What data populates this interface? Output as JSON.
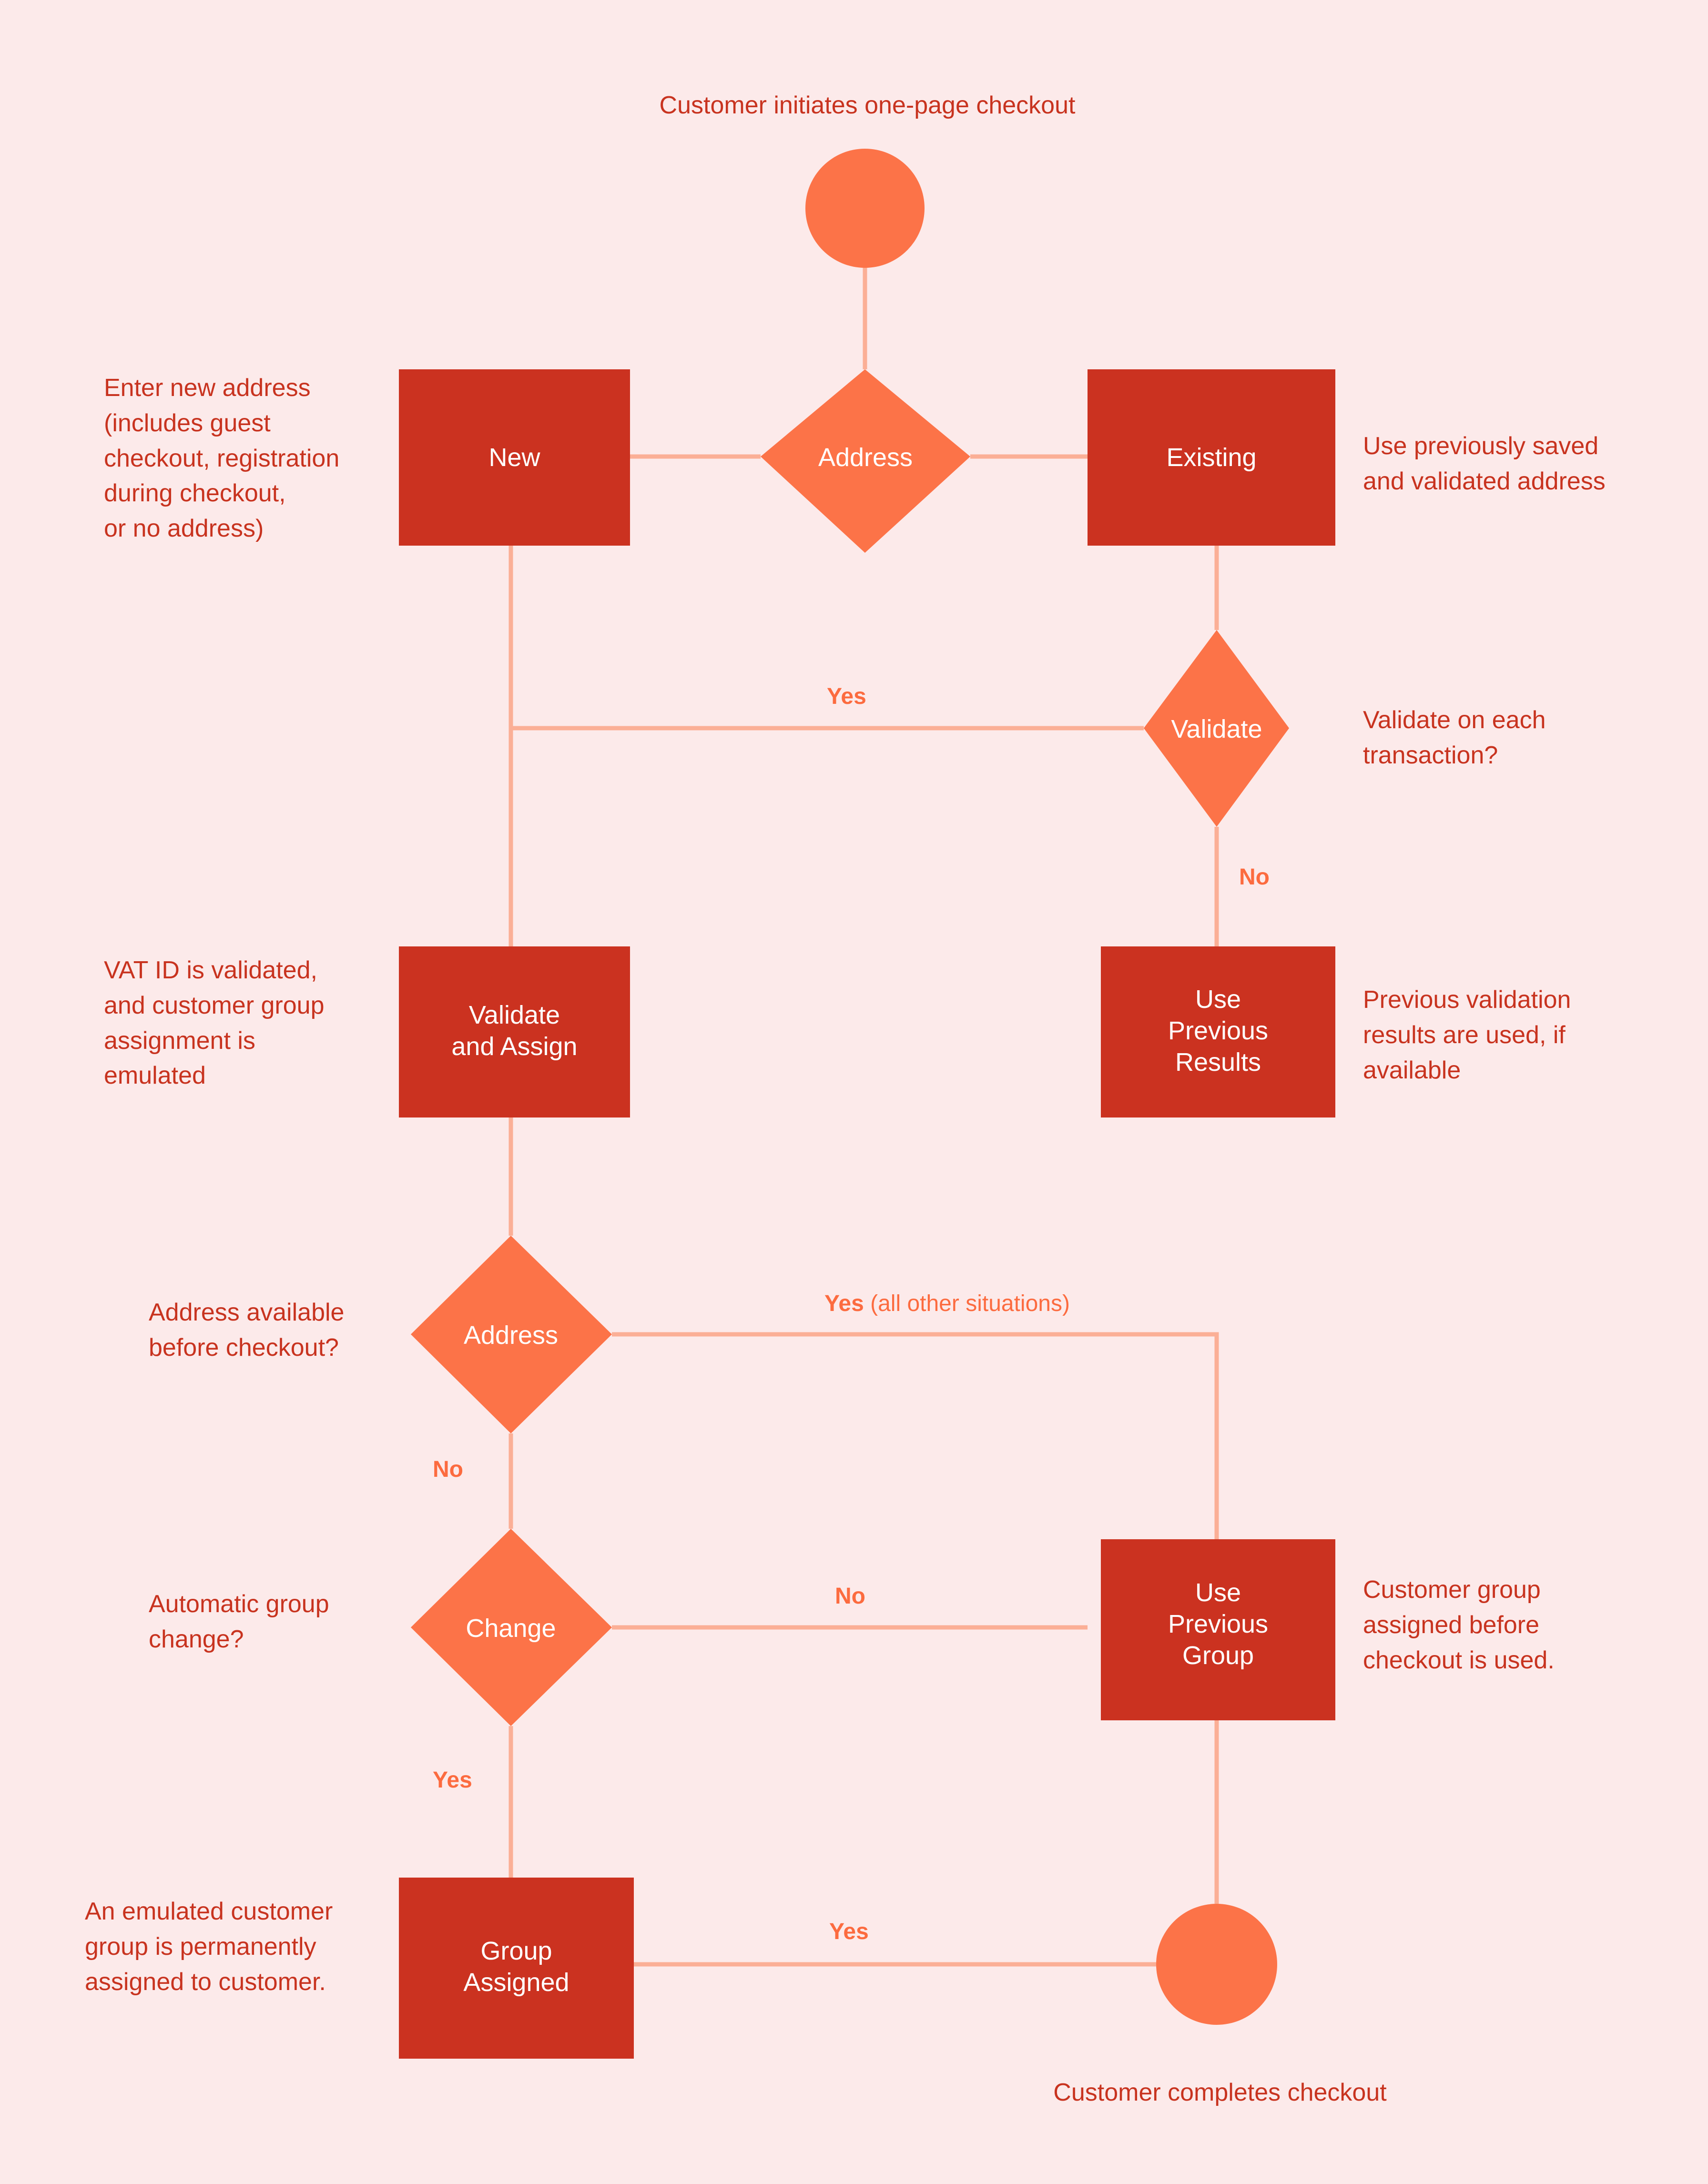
{
  "diagram": {
    "title": "Customer initiates one-page checkout",
    "footer": "Customer completes checkout",
    "colors": {
      "background": "#fceaea",
      "process_fill": "#cb3220",
      "decision_fill": "#fc7348",
      "terminator_fill": "#fc7348",
      "connector": "#fbaf96",
      "note_text": "#c8331f",
      "edge_label_text": "#fc5a28",
      "node_text": "#ffffff"
    },
    "nodes": [
      {
        "id": "start",
        "shape": "circle",
        "label": ""
      },
      {
        "id": "address_1",
        "shape": "diamond",
        "label": "Address"
      },
      {
        "id": "new",
        "shape": "process",
        "label": "New"
      },
      {
        "id": "existing",
        "shape": "process",
        "label": "Existing"
      },
      {
        "id": "validate",
        "shape": "diamond",
        "label": "Validate"
      },
      {
        "id": "validate_assign",
        "shape": "process",
        "label": "Validate\nand Assign"
      },
      {
        "id": "prev_results",
        "shape": "process",
        "label": "Use\nPrevious\nResults"
      },
      {
        "id": "address_2",
        "shape": "diamond",
        "label": "Address"
      },
      {
        "id": "change",
        "shape": "diamond",
        "label": "Change"
      },
      {
        "id": "prev_group",
        "shape": "process",
        "label": "Use\nPrevious\nGroup"
      },
      {
        "id": "group_assigned",
        "shape": "process",
        "label": "Group\nAssigned"
      },
      {
        "id": "end",
        "shape": "circle",
        "label": ""
      }
    ],
    "edge_labels": [
      {
        "id": "validate_yes",
        "text": "Yes",
        "sub": ""
      },
      {
        "id": "validate_no",
        "text": "No",
        "sub": ""
      },
      {
        "id": "address2_yes",
        "text": "Yes",
        "sub": "(all other situations)"
      },
      {
        "id": "address2_no",
        "text": "No",
        "sub": ""
      },
      {
        "id": "change_no",
        "text": "No",
        "sub": ""
      },
      {
        "id": "change_yes",
        "text": "Yes",
        "sub": ""
      },
      {
        "id": "group_yes",
        "text": "Yes",
        "sub": ""
      }
    ],
    "notes": [
      {
        "id": "note_new",
        "text": "Enter new address\n(includes guest\ncheckout, registration\nduring checkout,\nor no address)"
      },
      {
        "id": "note_existing",
        "text": "Use previously saved\nand validated address"
      },
      {
        "id": "note_validate",
        "text": "Validate on each\ntransaction?"
      },
      {
        "id": "note_validate_assign",
        "text": "VAT ID is validated,\nand customer group\nassignment is\nemulated"
      },
      {
        "id": "note_prev_results",
        "text": "Previous validation\nresults are used, if\navailable"
      },
      {
        "id": "note_address2",
        "text": "Address available\nbefore checkout?"
      },
      {
        "id": "note_change",
        "text": "Automatic group\nchange?"
      },
      {
        "id": "note_prev_group",
        "text": "Customer group\nassigned before\ncheckout is used."
      },
      {
        "id": "note_group_assigned",
        "text": "An emulated customer\ngroup is permanently\nassigned to customer."
      }
    ]
  }
}
